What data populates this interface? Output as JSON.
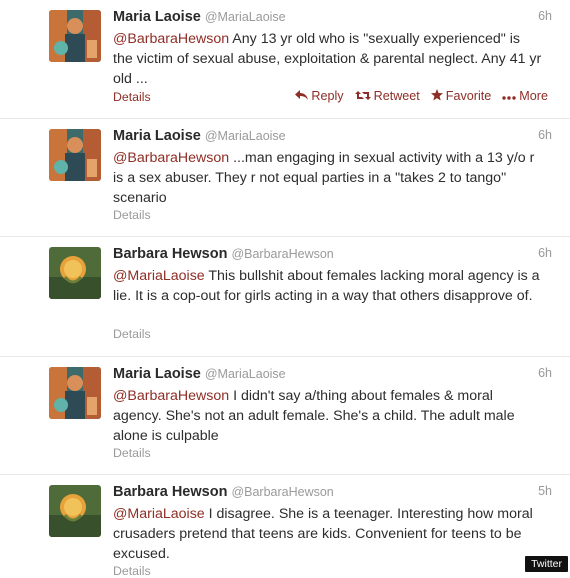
{
  "tweets": [
    {
      "name": "Maria Laoise",
      "handle": "@MariaLaoise",
      "time": "6h",
      "mention": "@BarbaraHewson",
      "body": " Any 13 yr old who is \"sexually experienced\" is the victim of sexual abuse, exploitation & parental neglect. Any 41 yr old ...",
      "details": "Details"
    },
    {
      "name": "Maria Laoise",
      "handle": "@MariaLaoise",
      "time": "6h",
      "mention": "@BarbaraHewson",
      "body": " ...man engaging in sexual activity with a 13 y/o r is a sex abuser. They r not equal parties in a \"takes 2 to tango\" scenario",
      "details": "Details"
    },
    {
      "name": "Barbara Hewson",
      "handle": "@BarbaraHewson",
      "time": "6h",
      "mention": "@MariaLaoise",
      "body": " This bullshit about females lacking moral agency is a lie. It is a cop-out for girls acting in a way that others disapprove of.",
      "details": "Details"
    },
    {
      "name": "Maria Laoise",
      "handle": "@MariaLaoise",
      "time": "6h",
      "mention": "@BarbaraHewson",
      "body": " I didn't say a/thing about females & moral agency. She's not an adult female. She's a child. The adult male alone is culpable",
      "details": "Details"
    },
    {
      "name": "Barbara Hewson",
      "handle": "@BarbaraHewson",
      "time": "5h",
      "mention": "@MariaLaoise",
      "body": " I disagree. She is a teenager. Interesting how moral crusaders pretend that teens are kids. Convenient for teens to be excused.",
      "details": "Details"
    }
  ],
  "actions": {
    "reply": "Reply",
    "retweet": "Retweet",
    "favorite": "Favorite",
    "more": "More",
    "reply_icon": "reply-arrow-icon",
    "retweet_icon": "retweet-icon",
    "favorite_icon": "star-icon",
    "more_icon": "ellipsis-icon"
  },
  "watermark": "Twitter",
  "colors": {
    "link": "#8f2e26",
    "muted": "#9a9a9a",
    "text": "#2d2d2d"
  }
}
